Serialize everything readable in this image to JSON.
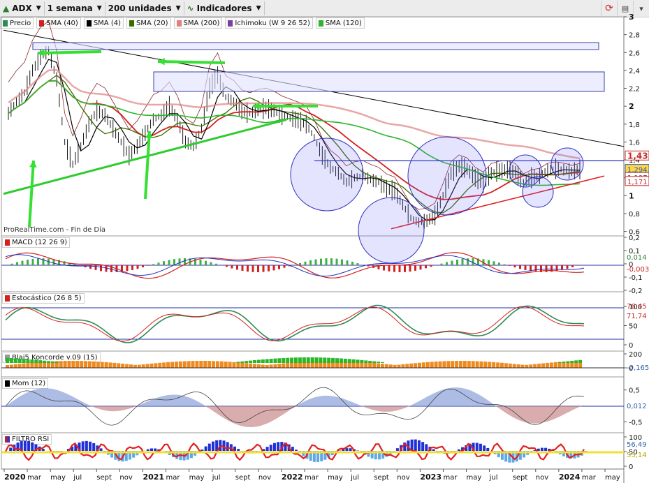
{
  "toolbar": {
    "symbol": "ADX",
    "period": "1 semana",
    "units": "200 unidades",
    "indicators": "Indicadores"
  },
  "watermark": "ProRealTime.com - Fin de Día",
  "legend": [
    {
      "label": "Precio",
      "color": "#2e8b57"
    },
    {
      "label": "SMA (40)",
      "color": "#d62020"
    },
    {
      "label": "SMA (4)",
      "color": "#000000"
    },
    {
      "label": "SMA (20)",
      "color": "#3a6b00"
    },
    {
      "label": "SMA (200)",
      "color": "#e08080"
    },
    {
      "label": "Ichimoku (W 9 26 52)",
      "color": "#7a3fa0"
    },
    {
      "label": "SMA (120)",
      "color": "#2db52d"
    }
  ],
  "panels": {
    "macd": "MACD (12 26 9)",
    "stoch": "Estocástico (26 8 5)",
    "koncorde": "Blai5 Koncorde v.09 (15)",
    "mom": "Mom (12)",
    "rsi": "FILTRO RSI"
  },
  "chart_data": [
    {
      "type": "line",
      "title": "ADX",
      "ylim": [
        0.55,
        3.0
      ],
      "yticks": [
        "3",
        "2,8",
        "2,6",
        "2,4",
        "2,2",
        "2",
        "1,8",
        "1,6",
        "1,4",
        "1,2",
        "1",
        "0,8",
        "0,6"
      ],
      "xticks": [
        "2020",
        "mar",
        "may",
        "jul",
        "sept",
        "nov",
        "2021",
        "mar",
        "may",
        "jul",
        "sept",
        "nov",
        "2022",
        "mar",
        "may",
        "jul",
        "sept",
        "nov",
        "2023",
        "mar",
        "may",
        "jul",
        "sept",
        "nov",
        "2024",
        "mar",
        "may"
      ],
      "price_tags": [
        "1,43",
        "1,294",
        "1,197",
        "1,171"
      ],
      "close": [
        1.92,
        2.05,
        2.15,
        2.4,
        2.55,
        2.62,
        2.3,
        1.6,
        1.35,
        1.55,
        1.8,
        1.95,
        1.9,
        1.75,
        1.6,
        1.45,
        1.55,
        1.7,
        1.85,
        1.9,
        2.0,
        1.85,
        1.6,
        1.55,
        1.75,
        2.2,
        2.35,
        2.1,
        2.05,
        1.95,
        1.92,
        1.96,
        1.98,
        1.95,
        1.9,
        1.87,
        1.84,
        1.8,
        1.65,
        1.45,
        1.32,
        1.25,
        1.15,
        1.2,
        1.22,
        1.18,
        1.15,
        1.08,
        1.05,
        0.9,
        0.75,
        0.7,
        0.72,
        0.78,
        1.0,
        1.25,
        1.33,
        1.3,
        1.2,
        1.15,
        1.25,
        1.28,
        1.29,
        1.26,
        1.15,
        1.2,
        1.22,
        1.28,
        1.3,
        1.29,
        1.27,
        1.294
      ]
    },
    {
      "type": "line",
      "title": "MACD (12 26 9)",
      "ylim": [
        -0.2,
        0.2
      ],
      "yticks": [
        "0,2",
        "0,1",
        "0",
        "-0,1",
        "-0,2"
      ],
      "value_tags": [
        "0,014",
        "-0,003"
      ]
    },
    {
      "type": "line",
      "title": "Estocástico (26 8 5)",
      "ylim": [
        0,
        100
      ],
      "yticks": [
        "100",
        "50",
        "0"
      ],
      "value_tags": [
        "76,45",
        "71,74"
      ]
    },
    {
      "type": "bar",
      "title": "Blai5 Koncorde v.09 (15)",
      "yticks": [
        "200",
        "0"
      ],
      "value_tags": [
        "-0,165"
      ]
    },
    {
      "type": "area",
      "title": "Mom (12)",
      "ylim": [
        -0.8,
        0.8
      ],
      "yticks": [
        "0,5",
        "-0,5"
      ],
      "value_tags": [
        "0,012"
      ]
    },
    {
      "type": "area",
      "title": "FILTRO RSI",
      "ylim": [
        0,
        100
      ],
      "yticks": [
        "100",
        "50",
        "0"
      ],
      "value_tags": [
        "56,49",
        "53,14"
      ]
    }
  ]
}
